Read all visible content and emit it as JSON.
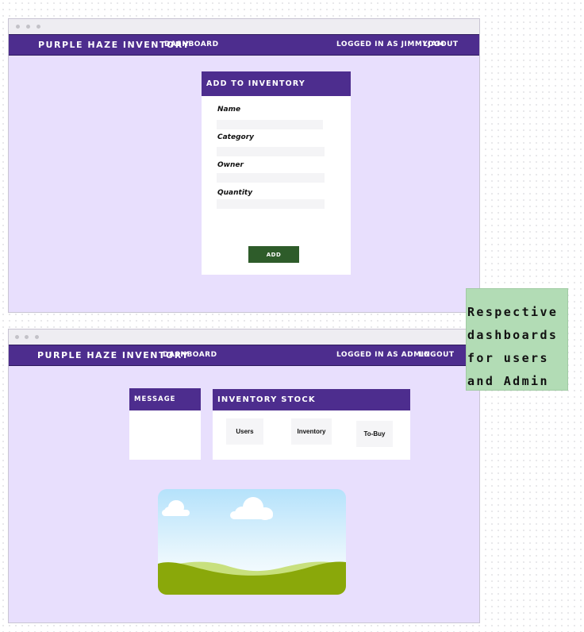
{
  "nav_user": {
    "brand": "Purple Haze Inventory",
    "dashboard_link": "Dashboard",
    "logged_in": "Logged in as jimmyjam",
    "logout": "Logout"
  },
  "add_form": {
    "title": "Add to Inventory",
    "fields": [
      {
        "label": "Name",
        "value": ""
      },
      {
        "label": "Category",
        "value": ""
      },
      {
        "label": "Owner",
        "value": ""
      },
      {
        "label": "Quantity",
        "value": ""
      }
    ],
    "add_button": "Add"
  },
  "nav_admin": {
    "brand": "Purple Haze Inventory",
    "dashboard_link": "Dashboard",
    "logged_in": "Logged in as Admin",
    "logout": "Logout"
  },
  "message_board": {
    "title": "Message Board"
  },
  "inventory_stock": {
    "title": "Inventory Stock",
    "buttons": [
      "Users",
      "Inventory",
      "To-Buy"
    ]
  },
  "image_placeholder": {
    "icon": "landscape-image-placeholder"
  },
  "sticky_note": {
    "lines": [
      "Respective",
      "dashboards",
      "for users",
      "and Admin"
    ]
  },
  "colors": {
    "nav_purple": "#4d2d8e",
    "window_bg": "#e8dffd",
    "add_button_green": "#2e5c2a",
    "note_green": "#b2dcb5"
  }
}
